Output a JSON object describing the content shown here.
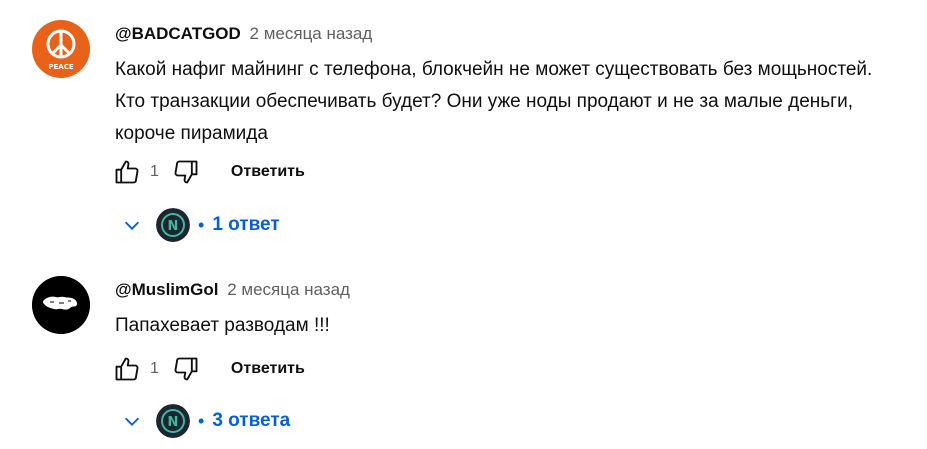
{
  "comments": [
    {
      "author": "@BADCATGOD",
      "time": "2 месяца назад",
      "avatar_text": "PEACE",
      "text": "Какой нафиг майнинг с телефона, блокчейн не может существовать без мощьностей. Кто транзакции обеспечивать будет? Они уже ноды продают и не за малые деньги, короче пирамида",
      "likes": "1",
      "reply_label": "Ответить",
      "replies_label": "1 ответ"
    },
    {
      "author": "@MuslimGol",
      "time": "2 месяца назад",
      "text": "Папахевает разводам !!!",
      "likes": "1",
      "reply_label": "Ответить",
      "replies_label": "3 ответа"
    }
  ],
  "colors": {
    "link_blue": "#065fd4",
    "avatar_orange": "#e8621a",
    "secondary_text": "#606060"
  },
  "icons": [
    "thumb-up-icon",
    "thumb-down-icon",
    "chevron-down-icon",
    "peace-icon",
    "world-map-icon"
  ]
}
